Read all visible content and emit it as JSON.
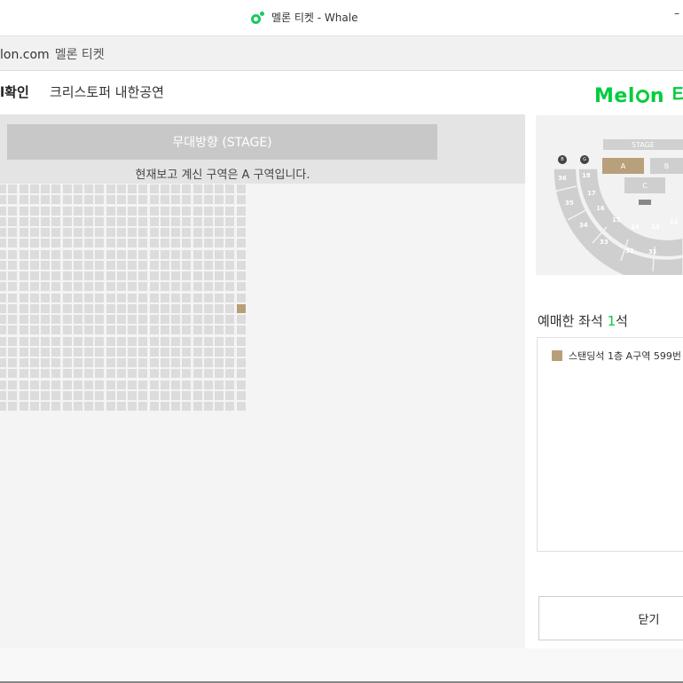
{
  "window": {
    "title": "멜론 티켓 - Whale",
    "minimize": "–"
  },
  "address": {
    "domain": "lon.com",
    "page_title": "멜론 티켓"
  },
  "header": {
    "step": "l확인",
    "concert": "크리스토퍼 내한공연"
  },
  "stage": {
    "label": "무대방향 (STAGE)",
    "zone_message": "현재보고 계신 구역은 A 구역입니다."
  },
  "seat_map": {
    "columns": 23,
    "rows": 21,
    "sold_seat": {
      "row": 11,
      "col": 22
    },
    "seat_color": "#dcdcdc",
    "sold_color": "#b89f7a"
  },
  "right": {
    "logo_text_pre": "Mel",
    "logo_text_post": "n 티켓",
    "minimap": {
      "stage": "STAGE",
      "blocks": [
        "A",
        "B",
        "C"
      ],
      "numbers": [
        "36",
        "18",
        "17",
        "35",
        "16",
        "34",
        "15",
        "14",
        "13",
        "12",
        "33",
        "32",
        "31"
      ],
      "markers": [
        "B",
        "G"
      ]
    },
    "booked": {
      "label": "예매한 좌석",
      "count": "1",
      "unit": "석",
      "item": "스탠딩석 1층 A구역 599번"
    },
    "close_label": "닫기"
  },
  "colors": {
    "melon_green": "#00cd3c",
    "sold_seat": "#b89f7a"
  }
}
